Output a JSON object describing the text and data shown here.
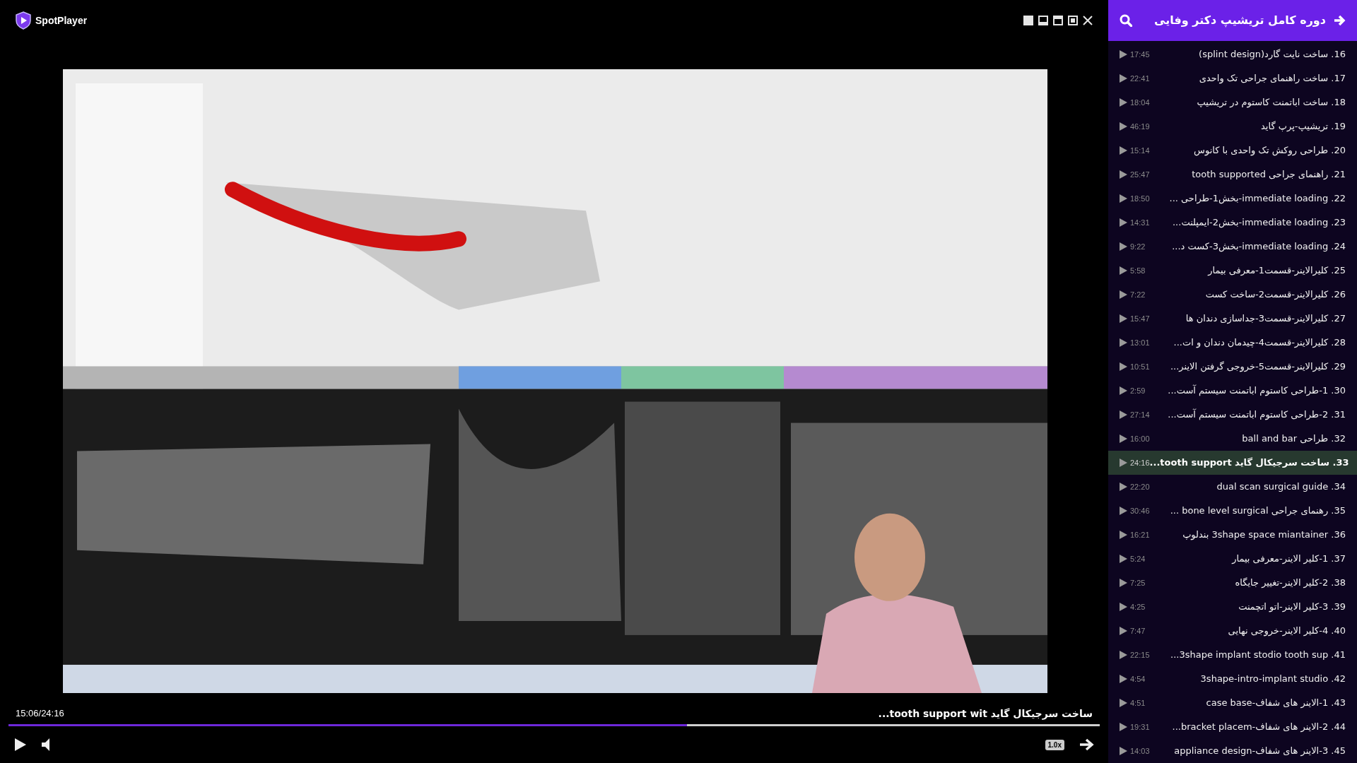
{
  "app": {
    "name": "SpotPlayer"
  },
  "player": {
    "time": "15:06/24:16",
    "title": "ساخت سرجیکال گاید tooth support wit...",
    "progress": {
      "level": 0.622
    },
    "speed": "1.0x"
  },
  "playlist": {
    "title": "دوره کامل تریشیپ دکتر وفایی",
    "items": [
      {
        "label": "16. ساخت نایت گارد(splint design)",
        "duration": "17:45",
        "selected": false
      },
      {
        "label": "17. ساخت راهنمای جراحی تک واحدی",
        "duration": "22:41",
        "selected": false
      },
      {
        "label": "18. ساخت اباتمنت کاستوم در تریشیپ",
        "duration": "18:04",
        "selected": false
      },
      {
        "label": "19. تریشیپ-پرپ گاید",
        "duration": "46:19",
        "selected": false
      },
      {
        "label": "20. طراحی روکش تک واحدی با کانوس",
        "duration": "15:14",
        "selected": false
      },
      {
        "label": "21. راهنمای جراحی  tooth supported",
        "duration": "25:47",
        "selected": false
      },
      {
        "label": "22. immediate loading-بخش1-طراحی ...",
        "duration": "18:50",
        "selected": false
      },
      {
        "label": "23. immediate loading-بخش2-ایمپلنت...",
        "duration": "14:31",
        "selected": false
      },
      {
        "label": "24. immediate loading-بخش3-کست د...",
        "duration": "9:22",
        "selected": false
      },
      {
        "label": "25. کلیرالاینر-قسمت1-معرفی بیمار",
        "duration": "5:58",
        "selected": false
      },
      {
        "label": "26. کلیرالاینر-قسمت2-ساخت کست",
        "duration": "7:22",
        "selected": false
      },
      {
        "label": "27. کلیرالاینر-قسمت3-جداسازی دندان ها",
        "duration": "15:47",
        "selected": false
      },
      {
        "label": "28. کلیرالاینر-قسمت4-چیدمان دندان و ات...",
        "duration": "13:01",
        "selected": false
      },
      {
        "label": "29. کلیرالاینر-قسمت5-خروجی گرفتن الاینر...",
        "duration": "10:51",
        "selected": false
      },
      {
        "label": "30. 1-طراحی کاستوم اباتمنت سیستم آست...",
        "duration": "2:59",
        "selected": false
      },
      {
        "label": "31. 2-طراحی کاستوم اباتمنت سیستم آست...",
        "duration": "27:14",
        "selected": false
      },
      {
        "label": "32. طراحی ball and bar",
        "duration": "16:00",
        "selected": false
      },
      {
        "label": "33. ساخت سرجیکال گاید tooth support...",
        "duration": "24:16",
        "selected": true
      },
      {
        "label": "34. dual scan surgical guide",
        "duration": "22:20",
        "selected": false
      },
      {
        "label": "35. رهنمای جراحی bone level surgical ...",
        "duration": "30:46",
        "selected": false
      },
      {
        "label": "36. 3shape space miantainer بندلوپ",
        "duration": "16:21",
        "selected": false
      },
      {
        "label": "37. 1-کلیر الاینر-معرفی بیمار",
        "duration": "5:24",
        "selected": false
      },
      {
        "label": "38. 2-کلیر الاینر-تغییر جایگاه",
        "duration": "7:25",
        "selected": false
      },
      {
        "label": "39. 3-کلیر الاینر-اتو اتچمنت",
        "duration": "4:25",
        "selected": false
      },
      {
        "label": "40. 4-کلیر الاینر-خروجی نهایی",
        "duration": "7:47",
        "selected": false
      },
      {
        "label": "41. 3shape implant stodio tooth sup...",
        "duration": "22:15",
        "selected": false
      },
      {
        "label": "42. 3shape-intro-implant studio",
        "duration": "4:54",
        "selected": false
      },
      {
        "label": "43. 1-الاینر های شفاف-case base",
        "duration": "4:51",
        "selected": false
      },
      {
        "label": "44. 2-الاینر های شفاف-bracket placem...",
        "duration": "19:31",
        "selected": false
      },
      {
        "label": "45. 3-الاینر های شفاف-appliance design",
        "duration": "14:03",
        "selected": false
      }
    ]
  }
}
